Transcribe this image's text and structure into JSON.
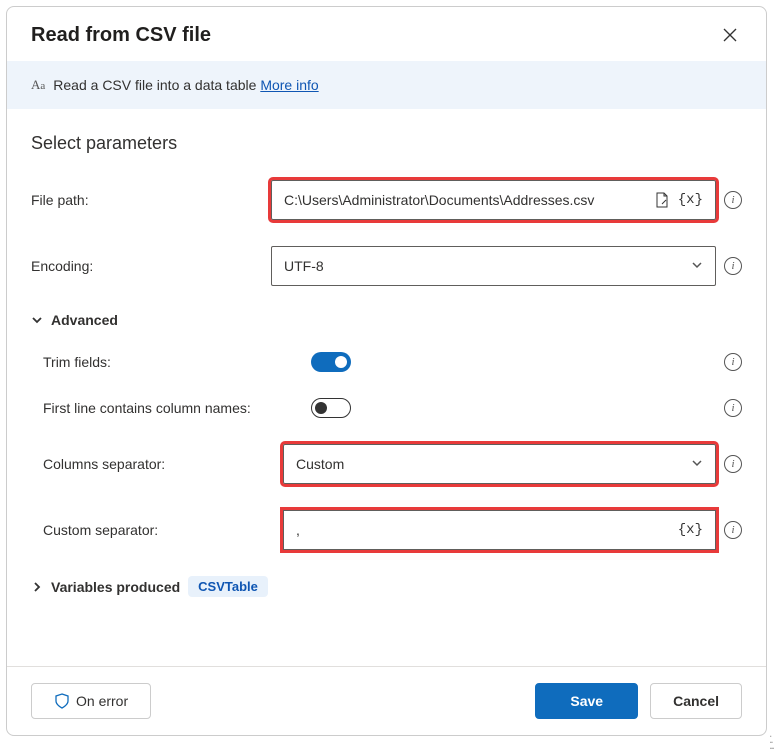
{
  "dialog": {
    "title": "Read from CSV file",
    "info_text": "Read a CSV file into a data table",
    "more_info": "More info"
  },
  "section": {
    "heading": "Select parameters"
  },
  "fields": {
    "file_path_label": "File path:",
    "file_path_value": "C:\\Users\\Administrator\\Documents\\Addresses.csv",
    "encoding_label": "Encoding:",
    "encoding_value": "UTF-8",
    "advanced": "Advanced",
    "trim_label": "Trim fields:",
    "first_line_label": "First line contains column names:",
    "col_sep_label": "Columns separator:",
    "col_sep_value": "Custom",
    "custom_sep_label": "Custom separator:",
    "custom_sep_value": ","
  },
  "variables": {
    "heading": "Variables produced",
    "name": "CSVTable"
  },
  "footer": {
    "on_error": "On error",
    "save": "Save",
    "cancel": "Cancel"
  },
  "toggles": {
    "trim_fields": true,
    "first_line_names": false
  },
  "highlights": [
    "file_path",
    "col_sep",
    "custom_sep"
  ]
}
